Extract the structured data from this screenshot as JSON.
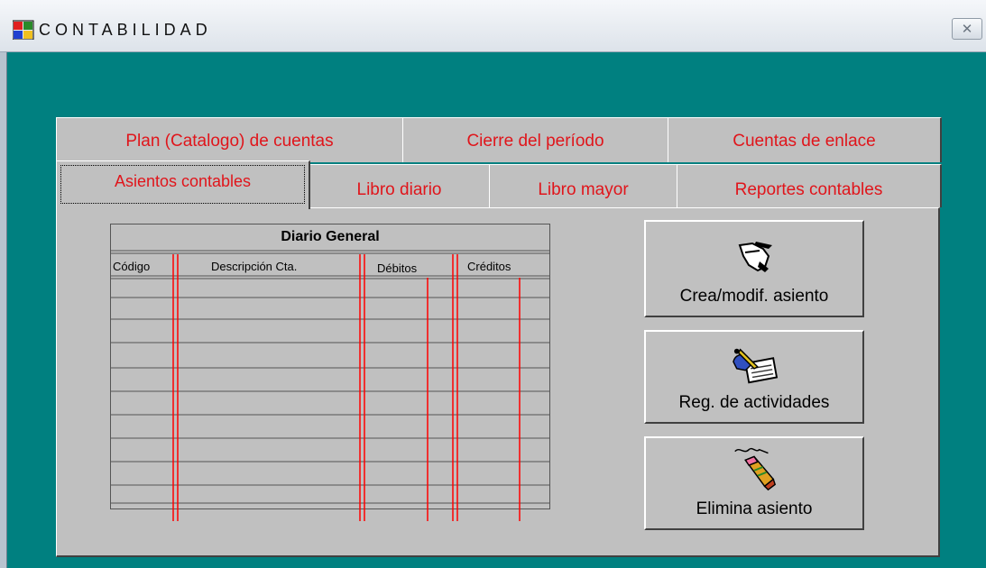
{
  "window": {
    "title": "CONTABILIDAD"
  },
  "tabs_row1": [
    {
      "label": "Plan (Catalogo) de cuentas"
    },
    {
      "label": "Cierre del período"
    },
    {
      "label": "Cuentas de enlace"
    }
  ],
  "tabs_row2": [
    {
      "label": "Asientos contables",
      "active": true
    },
    {
      "label": "Libro diario"
    },
    {
      "label": "Libro mayor"
    },
    {
      "label": "Reportes contables"
    }
  ],
  "journal": {
    "title": "Diario General",
    "columns": [
      "Código",
      "Descripción Cta.",
      "Débitos",
      "Créditos"
    ]
  },
  "buttons": [
    {
      "label": "Crea/modif. asiento",
      "icon": "hand-pen-icon"
    },
    {
      "label": "Reg. de actividades",
      "icon": "writing-pad-icon"
    },
    {
      "label": "Elimina asiento",
      "icon": "eraser-pencil-icon"
    }
  ],
  "colors": {
    "background": "#008080",
    "panel": "#c0c0c0",
    "tab_text": "#e0151b",
    "ledger_line": "#ff0000"
  }
}
